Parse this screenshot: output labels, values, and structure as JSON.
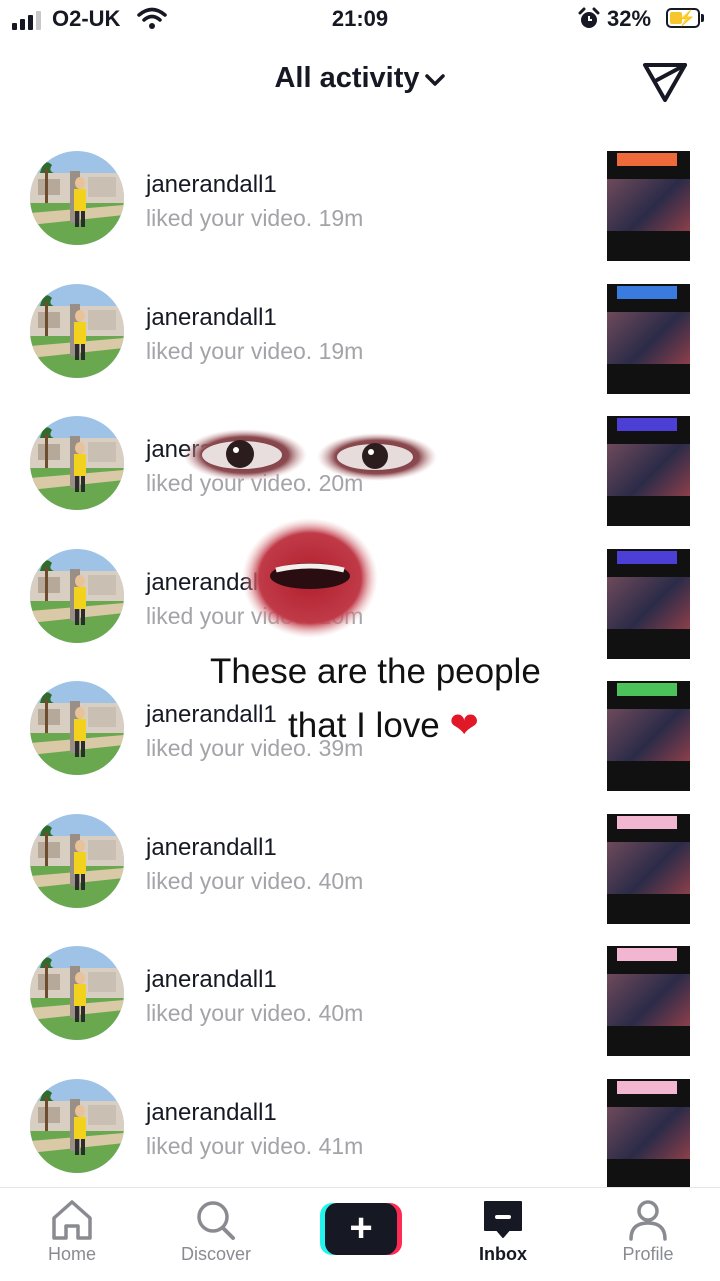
{
  "status_bar": {
    "carrier": "O2-UK",
    "time": "21:09",
    "battery": "32%",
    "battery_level": 0.32,
    "signal_bars": 3
  },
  "header": {
    "title": "All activity",
    "title_icon": "chevron-down-icon",
    "right_icon": "direct-message-icon"
  },
  "notifications": [
    {
      "username": "janerandall1",
      "action": "liked your video.",
      "time": "19m",
      "thumb_tag_color": "#ef6a3a"
    },
    {
      "username": "janerandall1",
      "action": "liked your video.",
      "time": "19m",
      "thumb_tag_color": "#3a7be0"
    },
    {
      "username": "janerandall1",
      "action": "liked your video.",
      "time": "20m",
      "thumb_tag_color": "#4b3fd6"
    },
    {
      "username": "janerandall1",
      "action": "liked your video.",
      "time": "20m",
      "thumb_tag_color": "#4b3fd6"
    },
    {
      "username": "janerandall1",
      "action": "liked your video.",
      "time": "39m",
      "thumb_tag_color": "#4cc25a"
    },
    {
      "username": "janerandall1",
      "action": "liked your video.",
      "time": "40m",
      "thumb_tag_color": "#f2b6d0"
    },
    {
      "username": "janerandall1",
      "action": "liked your video.",
      "time": "40m",
      "thumb_tag_color": "#f2b6d0"
    },
    {
      "username": "janerandall1",
      "action": "liked your video.",
      "time": "41m",
      "thumb_tag_color": "#f2b6d0"
    }
  ],
  "overlay": {
    "caption_line1": "These are the people",
    "caption_line2": "that I love",
    "caption_emoji": "❤"
  },
  "bottom_nav": {
    "home": "Home",
    "discover": "Discover",
    "create": "+",
    "inbox": "Inbox",
    "profile": "Profile",
    "active": "Inbox"
  },
  "colors": {
    "text": "#161823",
    "secondary": "#a3a3a8",
    "create_cyan": "#25f4ee",
    "create_pink": "#fe2c55"
  }
}
